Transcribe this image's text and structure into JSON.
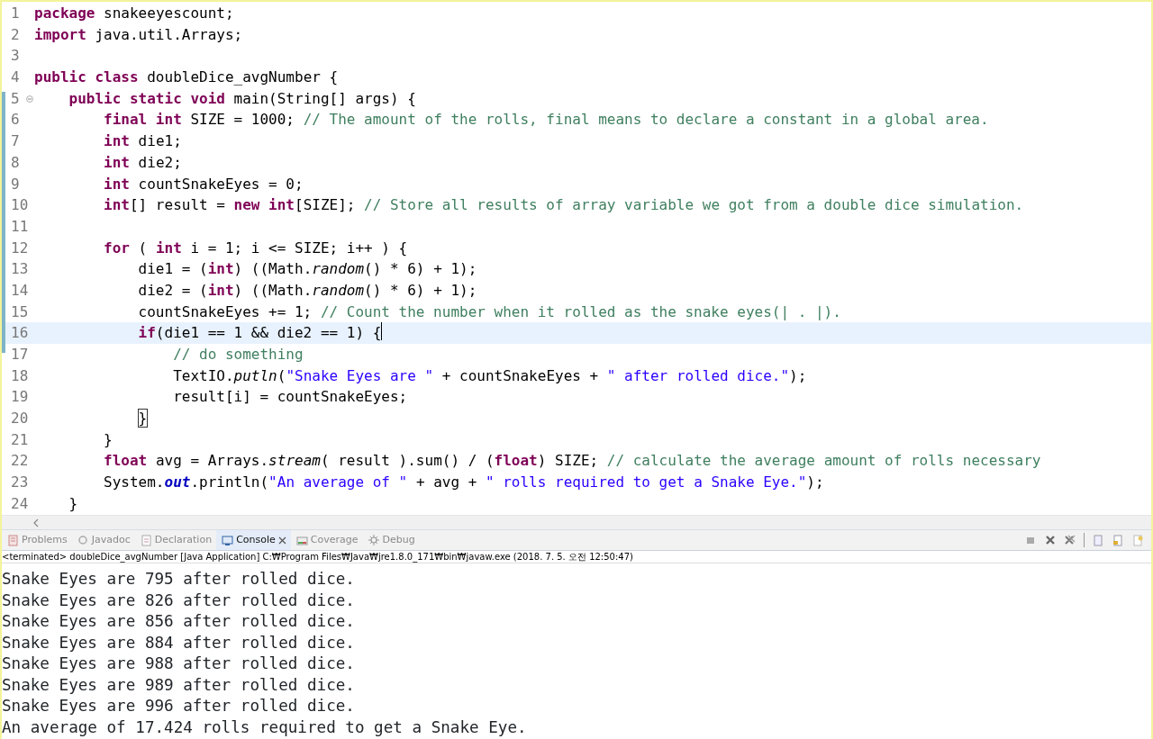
{
  "editor": {
    "lines": [
      {
        "number": "1",
        "current": false,
        "tokens": [
          {
            "kind": "keyword",
            "text": "package"
          },
          {
            "kind": "plain",
            "text": " snakeeyescount;"
          }
        ]
      },
      {
        "number": "2",
        "current": false,
        "tokens": [
          {
            "kind": "keyword",
            "text": "import"
          },
          {
            "kind": "plain",
            "text": " java.util.Arrays;"
          }
        ]
      },
      {
        "number": "3",
        "current": false
      },
      {
        "number": "4",
        "current": false,
        "tokens": [
          {
            "kind": "keyword",
            "text": "public class"
          },
          {
            "kind": "plain",
            "text": " doubleDice_avgNumber {"
          }
        ]
      },
      {
        "number": "5",
        "current": false,
        "folded": false,
        "tokens": [
          {
            "kind": "keyword",
            "text": "    public static void"
          },
          {
            "kind": "plain",
            "text": " main(String[] args) {"
          }
        ]
      },
      {
        "number": "6",
        "current": false,
        "tokens": [
          {
            "kind": "keyword",
            "text": "        final int"
          },
          {
            "kind": "plain",
            "text": " SIZE = 1000;"
          },
          {
            "kind": "comment",
            "text": " // The amount of the rolls, final means to declare a constant in a global area."
          }
        ]
      },
      {
        "number": "7",
        "current": false,
        "tokens": [
          {
            "kind": "keyword",
            "text": "        int"
          },
          {
            "kind": "plain",
            "text": " die1;"
          }
        ]
      },
      {
        "number": "8",
        "current": false,
        "tokens": [
          {
            "kind": "keyword",
            "text": "        int"
          },
          {
            "kind": "plain",
            "text": " die2;"
          }
        ]
      },
      {
        "number": "9",
        "current": false,
        "tokens": [
          {
            "kind": "keyword",
            "text": "        int"
          },
          {
            "kind": "plain",
            "text": " countSnakeEyes = 0;"
          }
        ]
      },
      {
        "number": "10",
        "current": false,
        "tokens": [
          {
            "kind": "keyword",
            "text": "        int"
          },
          {
            "kind": "plain",
            "text": "[] result = "
          },
          {
            "kind": "keyword",
            "text": "new int"
          },
          {
            "kind": "plain",
            "text": "[SIZE];"
          },
          {
            "kind": "comment",
            "text": " // Store all results of array variable we got from a double dice simulation."
          }
        ]
      },
      {
        "number": "11",
        "current": false
      },
      {
        "number": "12",
        "current": false,
        "tokens": [
          {
            "kind": "keyword",
            "text": "        for"
          },
          {
            "kind": "plain",
            "text": " ( "
          },
          {
            "kind": "keyword",
            "text": "int"
          },
          {
            "kind": "plain",
            "text": " i = 1; i <= SIZE; i++ ) {"
          }
        ]
      },
      {
        "number": "13",
        "current": false,
        "tokens": [
          {
            "kind": "plain",
            "text": "            die1 = ("
          },
          {
            "kind": "keyword",
            "text": "int"
          },
          {
            "kind": "plain",
            "text": ") ((Math."
          },
          {
            "kind": "method",
            "text": "random"
          },
          {
            "kind": "plain",
            "text": "() * 6) + 1);"
          }
        ]
      },
      {
        "number": "14",
        "current": false,
        "tokens": [
          {
            "kind": "plain",
            "text": "            die2 = ("
          },
          {
            "kind": "keyword",
            "text": "int"
          },
          {
            "kind": "plain",
            "text": ") ((Math."
          },
          {
            "kind": "method",
            "text": "random"
          },
          {
            "kind": "plain",
            "text": "() * 6) + 1);"
          }
        ]
      },
      {
        "number": "15",
        "current": false,
        "tokens": [
          {
            "kind": "plain",
            "text": "            countSnakeEyes += 1;"
          },
          {
            "kind": "comment",
            "text": " // Count the number when it rolled as the snake eyes(| . |)."
          }
        ]
      },
      {
        "number": "16",
        "current": true,
        "tokens": [
          {
            "kind": "keyword",
            "text": "            if"
          },
          {
            "kind": "plain",
            "text": "(die1 == 1 && die2 == 1) {"
          }
        ]
      },
      {
        "number": "17",
        "current": false,
        "tokens": [
          {
            "kind": "comment",
            "text": "                // do something"
          }
        ]
      },
      {
        "number": "18",
        "current": false,
        "tokens": [
          {
            "kind": "plain",
            "text": "                TextIO."
          },
          {
            "kind": "method",
            "text": "putln"
          },
          {
            "kind": "plain",
            "text": "("
          },
          {
            "kind": "string",
            "text": "\"Snake Eyes are \""
          },
          {
            "kind": "plain",
            "text": " + countSnakeEyes + "
          },
          {
            "kind": "string",
            "text": "\" after rolled dice.\""
          },
          {
            "kind": "plain",
            "text": ");"
          }
        ]
      },
      {
        "number": "19",
        "current": false,
        "tokens": [
          {
            "kind": "plain",
            "text": "                result[i] = countSnakeEyes;"
          }
        ]
      },
      {
        "number": "20",
        "current": false,
        "tokens": [
          {
            "kind": "match",
            "text": "            }"
          }
        ]
      },
      {
        "number": "21",
        "current": false,
        "tokens": [
          {
            "kind": "plain",
            "text": "        }"
          }
        ]
      },
      {
        "number": "22",
        "current": false,
        "tokens": [
          {
            "kind": "keyword",
            "text": "        float"
          },
          {
            "kind": "plain",
            "text": " avg = Arrays."
          },
          {
            "kind": "method",
            "text": "stream"
          },
          {
            "kind": "plain",
            "text": "( result ).sum() / ("
          },
          {
            "kind": "keyword",
            "text": "float"
          },
          {
            "kind": "plain",
            "text": ") SIZE;"
          },
          {
            "kind": "comment",
            "text": " // calculate the average amount of rolls necessary"
          }
        ]
      },
      {
        "number": "23",
        "current": false,
        "tokens": [
          {
            "kind": "plain",
            "text": "        System."
          },
          {
            "kind": "field",
            "text": "out"
          },
          {
            "kind": "plain",
            "text": ".println("
          },
          {
            "kind": "string",
            "text": "\"An average of \""
          },
          {
            "kind": "plain",
            "text": " + avg + "
          },
          {
            "kind": "string",
            "text": "\" rolls required to get a Snake Eye.\""
          },
          {
            "kind": "plain",
            "text": ");"
          }
        ]
      },
      {
        "number": "24",
        "current": false,
        "tokens": [
          {
            "kind": "plain",
            "text": "    }"
          }
        ]
      }
    ]
  },
  "views": {
    "tabs": [
      {
        "label": "Problems",
        "selected": false
      },
      {
        "label": "Javadoc",
        "selected": false
      },
      {
        "label": "Declaration",
        "selected": false
      },
      {
        "label": "Console",
        "selected": true
      },
      {
        "label": "Coverage",
        "selected": false
      },
      {
        "label": "Debug",
        "selected": false
      }
    ]
  },
  "console": {
    "launch": "<terminated> doubleDice_avgNumber [Java Application] C:₩Program Files₩Java₩jre1.8.0_171₩bin₩javaw.exe (2018. 7. 5. 오전 12:50:47)",
    "lines": [
      "Snake Eyes are 795 after rolled dice.",
      "Snake Eyes are 826 after rolled dice.",
      "Snake Eyes are 856 after rolled dice.",
      "Snake Eyes are 884 after rolled dice.",
      "Snake Eyes are 988 after rolled dice.",
      "Snake Eyes are 989 after rolled dice.",
      "Snake Eyes are 996 after rolled dice.",
      "An average of 17.424 rolls required to get a Snake Eye."
    ]
  }
}
